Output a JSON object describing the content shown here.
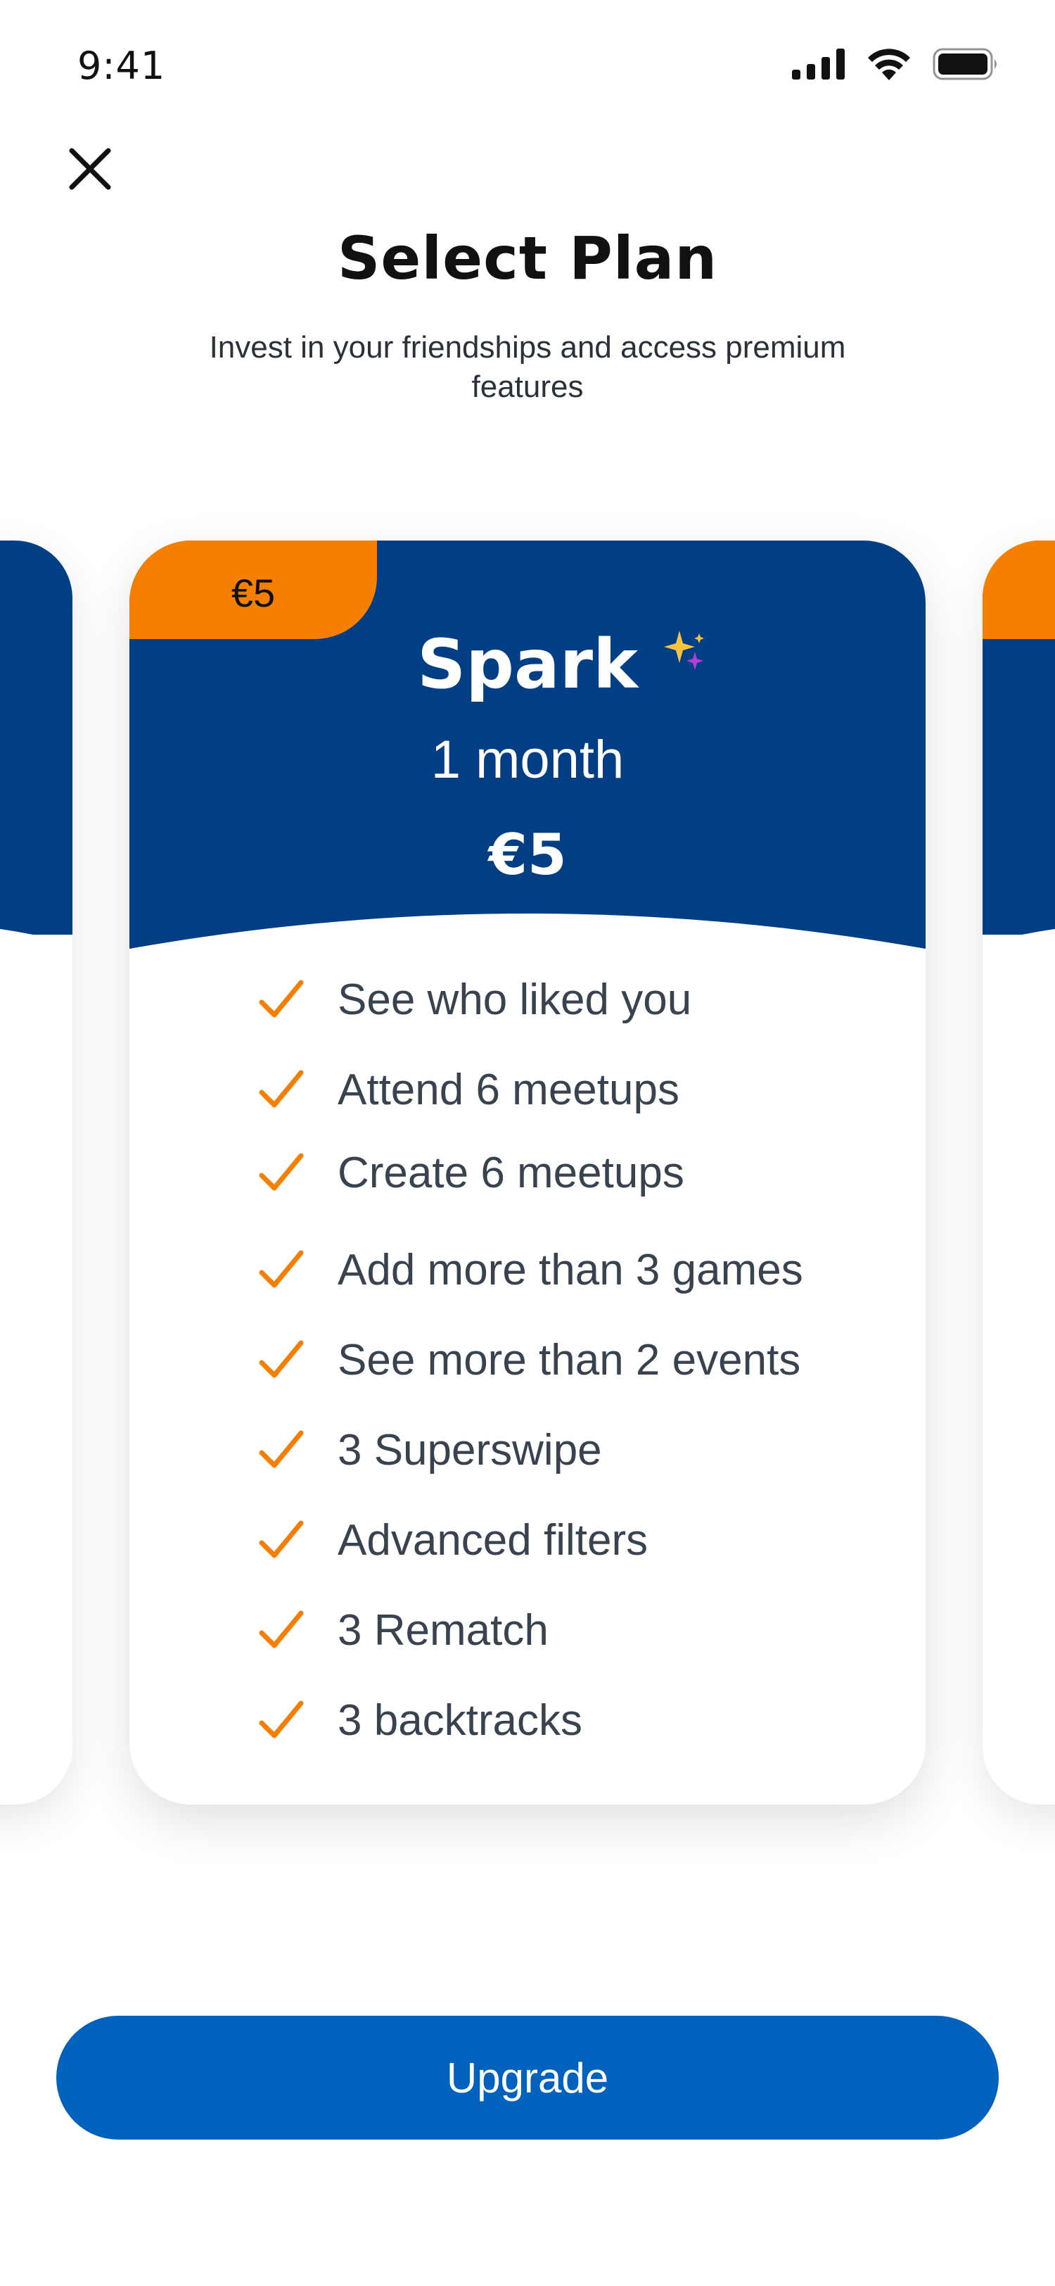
{
  "status_bar": {
    "time": "9:41"
  },
  "header": {
    "title": "Select Plan",
    "subtitle": "Invest in your friendships and access premium features"
  },
  "plan_card": {
    "badge_price": "€5",
    "name": "Spark",
    "duration": "1 month",
    "price": "€5",
    "features": [
      "See who liked you",
      "Attend 6 meetups",
      "Create 6 meetups",
      "Add more than 3 games",
      "See more than 2 events",
      "3 Superswipe",
      "Advanced filters",
      "3 Rematch",
      "3 backtracks"
    ]
  },
  "actions": {
    "upgrade_label": "Upgrade"
  },
  "colors": {
    "card_header": "#023e84",
    "accent_orange": "#f77f00",
    "primary_button": "#0062bd"
  },
  "icons": {
    "close": "close-icon",
    "check": "check-icon",
    "sparkle": "sparkle-icon",
    "signal": "cellular-signal-icon",
    "wifi": "wifi-icon",
    "battery": "battery-icon"
  }
}
